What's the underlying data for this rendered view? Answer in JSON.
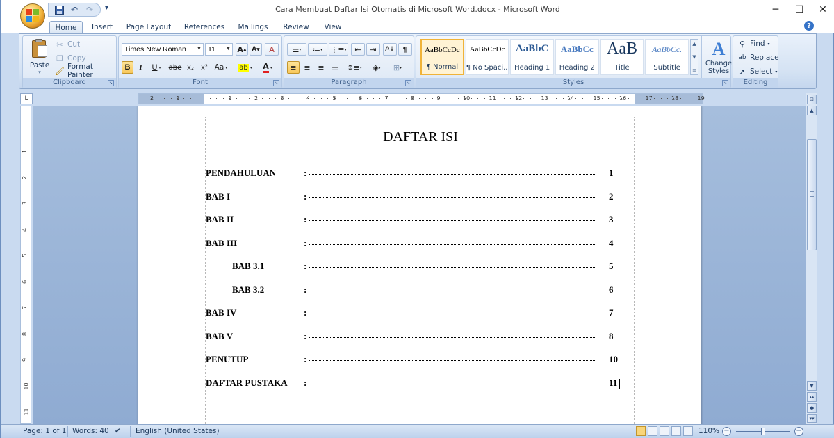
{
  "window": {
    "title": "Cara Membuat Daftar Isi Otomatis di Microsoft Word.docx - Microsoft Word",
    "minimize": "─",
    "maximize": "☐",
    "close": "✕"
  },
  "tabs": [
    {
      "label": "Home",
      "active": true
    },
    {
      "label": "Insert"
    },
    {
      "label": "Page Layout"
    },
    {
      "label": "References"
    },
    {
      "label": "Mailings"
    },
    {
      "label": "Review"
    },
    {
      "label": "View"
    }
  ],
  "ribbon": {
    "clipboard": {
      "label": "Clipboard",
      "paste": "Paste",
      "cut": "Cut",
      "copy": "Copy",
      "format_painter": "Format Painter"
    },
    "font": {
      "label": "Font",
      "font_name": "Times New Roman",
      "font_size": "11",
      "grow": "A",
      "shrink": "A",
      "clear": "A",
      "bold": "B",
      "italic": "I",
      "underline": "U",
      "strike": "abe",
      "subscript": "x₂",
      "superscript": "x²",
      "change_case": "Aa",
      "highlight": "ab",
      "font_color": "A"
    },
    "paragraph": {
      "label": "Paragraph"
    },
    "styles": {
      "label": "Styles",
      "items": [
        {
          "sample": "AaBbCcDc",
          "name": "¶ Normal",
          "selected": true
        },
        {
          "sample": "AaBbCcDc",
          "name": "¶ No Spaci..."
        },
        {
          "sample": "AaBbC",
          "name": "Heading 1"
        },
        {
          "sample": "AaBbCc",
          "name": "Heading 2"
        },
        {
          "sample": "AaB",
          "name": "Title"
        },
        {
          "sample": "AaBbCc.",
          "name": "Subtitle"
        }
      ],
      "change_styles": "Change Styles",
      "change_styles_icon": "A"
    },
    "editing": {
      "label": "Editing",
      "find": "Find",
      "replace": "Replace",
      "select": "Select"
    }
  },
  "ruler": {
    "corner": "L",
    "ticks": [
      "2",
      "1",
      "1",
      "2",
      "3",
      "4",
      "5",
      "6",
      "7",
      "8",
      "9",
      "10",
      "11",
      "12",
      "13",
      "14",
      "15",
      "16",
      "17",
      "18",
      "19"
    ],
    "vticks": [
      "1",
      "2",
      "3",
      "4",
      "5",
      "6",
      "7",
      "8",
      "9",
      "10",
      "11"
    ]
  },
  "document": {
    "title": "DAFTAR ISI",
    "toc": [
      {
        "label": "PENDAHULUAN",
        "colon": ":",
        "page": "1",
        "indent": false
      },
      {
        "label": "BAB I",
        "colon": ":",
        "page": "2",
        "indent": false
      },
      {
        "label": "BAB II",
        "colon": ":",
        "page": "3",
        "indent": false
      },
      {
        "label": "BAB III",
        "colon": ":",
        "page": "4",
        "indent": false
      },
      {
        "label": "BAB 3.1",
        "colon": ":",
        "page": "5",
        "indent": true
      },
      {
        "label": "BAB 3.2",
        "colon": ":",
        "page": "6",
        "indent": true
      },
      {
        "label": "BAB IV",
        "colon": ":",
        "page": "7",
        "indent": false
      },
      {
        "label": "BAB V",
        "colon": ":",
        "page": "8",
        "indent": false
      },
      {
        "label": "PENUTUP",
        "colon": ":",
        "page": "10",
        "indent": false
      },
      {
        "label": "DAFTAR PUSTAKA",
        "colon": ":",
        "page": "11",
        "indent": false
      }
    ]
  },
  "statusbar": {
    "page": "Page: 1 of 1",
    "words": "Words: 40",
    "language": "English (United States)",
    "zoom": "110%",
    "zoom_minus": "−",
    "zoom_plus": "+"
  },
  "colors": {
    "ribbon_bg": "#d4e2f3",
    "doc_bg": "#9bb5d8",
    "accent": "#1e395b"
  }
}
